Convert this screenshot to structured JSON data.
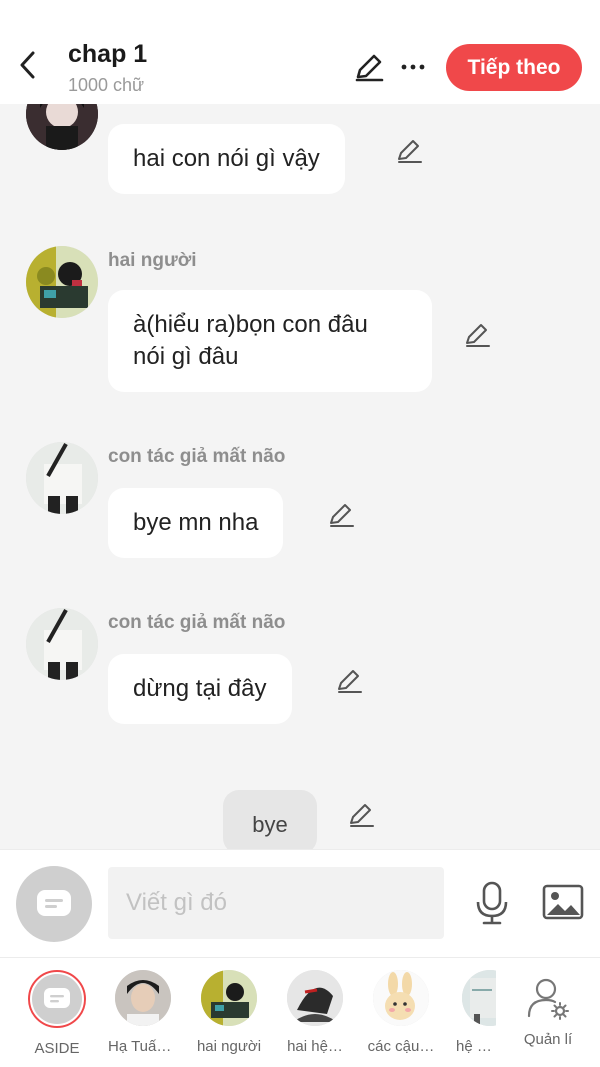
{
  "header": {
    "title": "chap 1",
    "subtitle": "1000 chữ",
    "next_label": "Tiếp theo"
  },
  "messages": [
    {
      "name": "",
      "text": "hai con nói gì vậy"
    },
    {
      "name": "hai người",
      "text": "à(hiểu ra)bọn con đâu\nnói gì đâu"
    },
    {
      "name": "con tác giả mất não",
      "text": "bye mn nha"
    },
    {
      "name": "con tác giả mất não",
      "text": "dừng tại đây"
    }
  ],
  "narration": {
    "text": "bye"
  },
  "composer": {
    "placeholder": "Viết gì đó"
  },
  "characters": [
    {
      "label": "ASIDE",
      "icon": "chat-bubble-icon"
    },
    {
      "label": "Hạ Tuấn…",
      "icon": "avatar"
    },
    {
      "label": "hai người",
      "icon": "avatar"
    },
    {
      "label": "hai hệ…",
      "icon": "avatar"
    },
    {
      "label": "các cậu…",
      "icon": "avatar"
    },
    {
      "label": "hệ thố",
      "icon": "avatar"
    }
  ],
  "manage": {
    "label": "Quản lí",
    "icon": "user-settings-icon"
  },
  "colors": {
    "accent": "#f0484a",
    "background": "#f4f4f4",
    "bubble": "#ffffff"
  }
}
